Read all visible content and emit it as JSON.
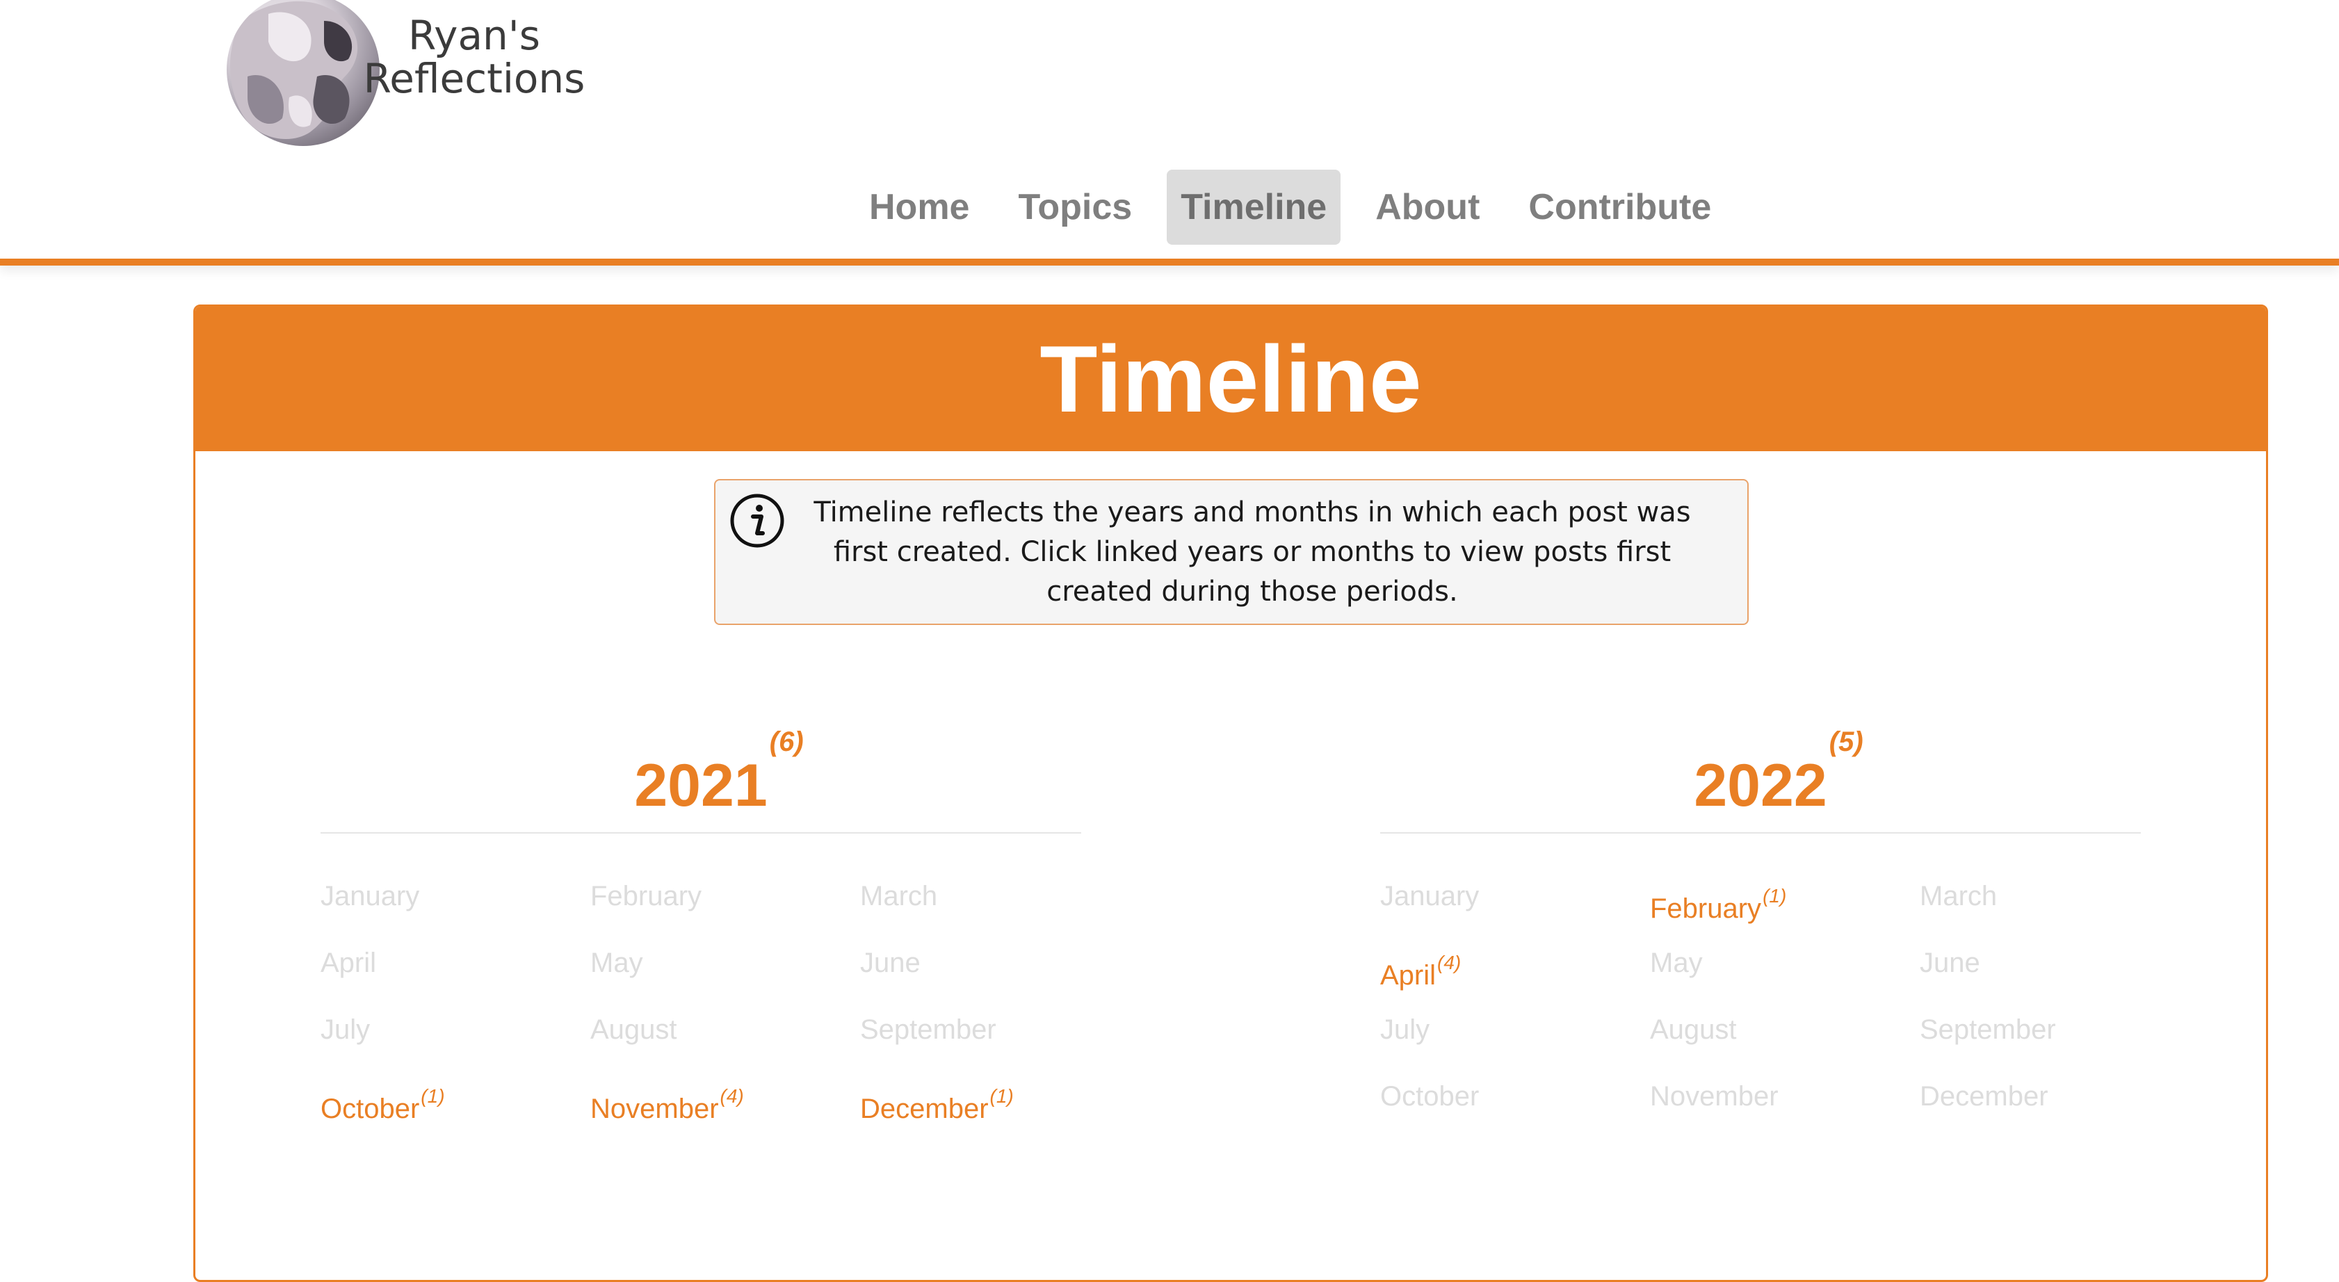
{
  "site": {
    "logo_line1": "Ryan's",
    "logo_line2": "Reflections"
  },
  "nav": {
    "items": [
      {
        "label": "Home",
        "active": false
      },
      {
        "label": "Topics",
        "active": false
      },
      {
        "label": "Timeline",
        "active": true
      },
      {
        "label": "About",
        "active": false
      },
      {
        "label": "Contribute",
        "active": false
      }
    ]
  },
  "page": {
    "title": "Timeline",
    "info": "Timeline reflects the years and months in which each post was first created. Click linked years or months to view posts first created during those periods."
  },
  "years": [
    {
      "year": "2021",
      "count": "(6)",
      "months": [
        {
          "label": "January",
          "count": ""
        },
        {
          "label": "February",
          "count": ""
        },
        {
          "label": "March",
          "count": ""
        },
        {
          "label": "April",
          "count": ""
        },
        {
          "label": "May",
          "count": ""
        },
        {
          "label": "June",
          "count": ""
        },
        {
          "label": "July",
          "count": ""
        },
        {
          "label": "August",
          "count": ""
        },
        {
          "label": "September",
          "count": ""
        },
        {
          "label": "October",
          "count": "(1)"
        },
        {
          "label": "November",
          "count": "(4)"
        },
        {
          "label": "December",
          "count": "(1)"
        }
      ]
    },
    {
      "year": "2022",
      "count": "(5)",
      "months": [
        {
          "label": "January",
          "count": ""
        },
        {
          "label": "February",
          "count": "(1)"
        },
        {
          "label": "March",
          "count": ""
        },
        {
          "label": "April",
          "count": "(4)"
        },
        {
          "label": "May",
          "count": ""
        },
        {
          "label": "June",
          "count": ""
        },
        {
          "label": "July",
          "count": ""
        },
        {
          "label": "August",
          "count": ""
        },
        {
          "label": "September",
          "count": ""
        },
        {
          "label": "October",
          "count": ""
        },
        {
          "label": "November",
          "count": ""
        },
        {
          "label": "December",
          "count": ""
        }
      ]
    }
  ],
  "colors": {
    "accent": "#e97f24",
    "nav_text": "#7f7f7f",
    "nav_active_bg": "#dcdcdc",
    "month_inactive": "#dcdcdc",
    "info_bg": "#f5f5f5"
  },
  "icons": {
    "info": "info-circle-icon",
    "logo": "statue-logo-image"
  }
}
